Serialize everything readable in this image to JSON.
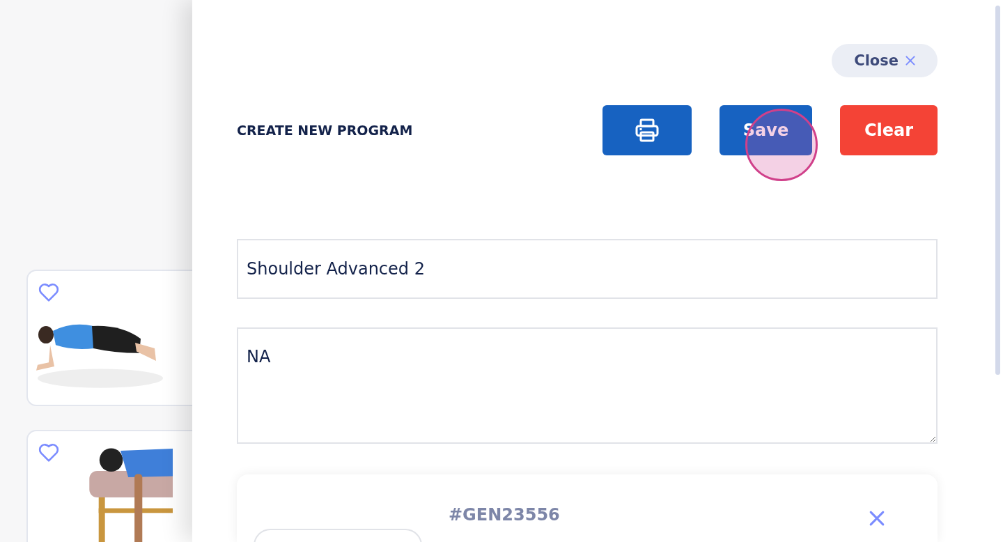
{
  "exercise_cards": [
    {
      "favorite": false
    },
    {
      "favorite": false
    }
  ],
  "panel": {
    "close_button": "Close",
    "title": "CREATE NEW PROGRAM",
    "save_button": "Save",
    "clear_button": "Clear",
    "program_name": "Shoulder Advanced 2",
    "description": "NA",
    "exercises": [
      {
        "code": "#GEN23556"
      }
    ]
  }
}
